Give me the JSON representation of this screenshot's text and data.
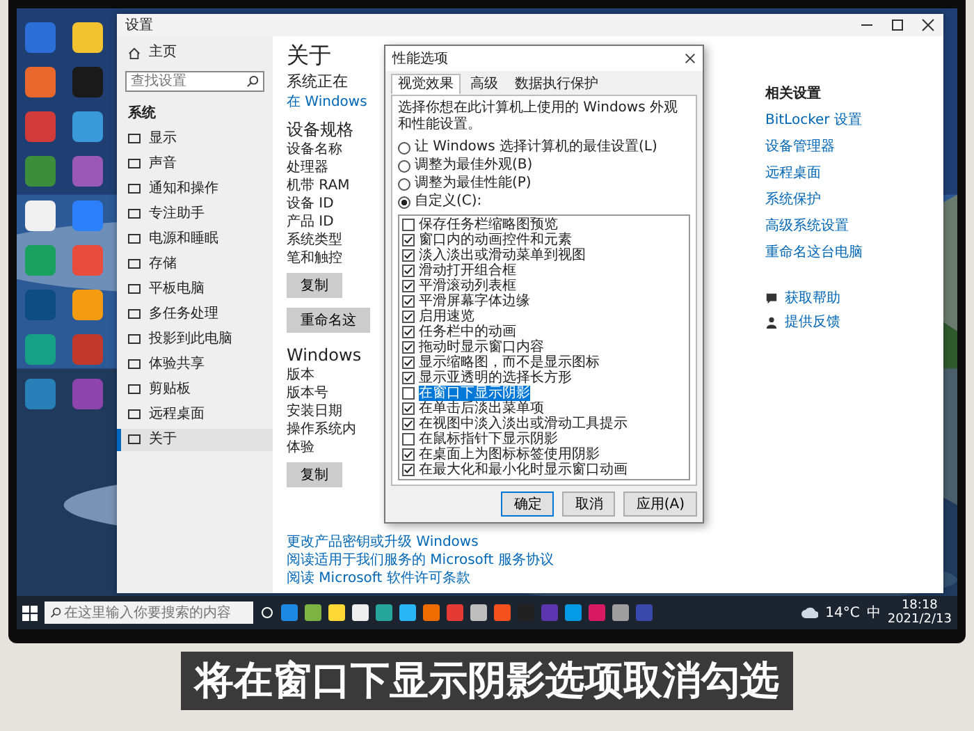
{
  "desktop_icons": [
    {
      "color": "#2b6fd6"
    },
    {
      "color": "#f2c230"
    },
    {
      "color": "#e8672c"
    },
    {
      "color": "#1a1a1a"
    },
    {
      "color": "#d23b3b"
    },
    {
      "color": "#3a9ad9"
    },
    {
      "color": "#3c8d3c"
    },
    {
      "color": "#9b59b6"
    },
    {
      "color": "#f0f0f0"
    },
    {
      "color": "#2d7ff9"
    },
    {
      "color": "#1aa15f"
    },
    {
      "color": "#e84c3d"
    },
    {
      "color": "#0f4c81"
    },
    {
      "color": "#f39c12"
    },
    {
      "color": "#16a085"
    },
    {
      "color": "#c0392b"
    },
    {
      "color": "#2980b9"
    },
    {
      "color": "#8e44ad"
    }
  ],
  "settings_window": {
    "title": "设置",
    "sidebar": {
      "home": "主页",
      "search_placeholder": "查找设置",
      "section": "系统",
      "items": [
        {
          "label": "显示",
          "selected": false
        },
        {
          "label": "声音",
          "selected": false
        },
        {
          "label": "通知和操作",
          "selected": false
        },
        {
          "label": "专注助手",
          "selected": false
        },
        {
          "label": "电源和睡眠",
          "selected": false
        },
        {
          "label": "存储",
          "selected": false
        },
        {
          "label": "平板电脑",
          "selected": false
        },
        {
          "label": "多任务处理",
          "selected": false
        },
        {
          "label": "投影到此电脑",
          "selected": false
        },
        {
          "label": "体验共享",
          "selected": false
        },
        {
          "label": "剪贴板",
          "selected": false
        },
        {
          "label": "远程桌面",
          "selected": false
        },
        {
          "label": "关于",
          "selected": true
        }
      ]
    },
    "main": {
      "title": "关于",
      "status": "系统正在",
      "security_link": "在 Windows",
      "specs_heading": "设备规格",
      "device_labels": [
        "设备名称",
        "处理器",
        "机带 RAM",
        "设备 ID",
        "产品 ID",
        "系统类型",
        "笔和触控"
      ],
      "copy_button": "复制",
      "rename_button": "重命名这",
      "windows_heading": "Windows",
      "windows_labels": [
        "版本",
        "版本号",
        "安装日期",
        "操作系统内",
        "体验"
      ],
      "copy_button_2": "复制",
      "links": [
        "更改产品密钥或升级 Windows",
        "阅读适用于我们服务的 Microsoft 服务协议",
        "阅读 Microsoft 软件许可条款"
      ]
    },
    "related": {
      "heading": "相关设置",
      "links": [
        "BitLocker 设置",
        "设备管理器",
        "远程桌面",
        "系统保护",
        "高级系统设置",
        "重命名这台电脑"
      ],
      "help_links": [
        "获取帮助",
        "提供反馈"
      ]
    }
  },
  "performance_dialog": {
    "title": "性能选项",
    "tabs": [
      {
        "label": "视觉效果",
        "selected": true
      },
      {
        "label": "高级",
        "selected": false
      },
      {
        "label": "数据执行保护",
        "selected": false
      }
    ],
    "description": "选择你想在此计算机上使用的 Windows 外观和性能设置。",
    "options": [
      {
        "label": "让 Windows 选择计算机的最佳设置(L)",
        "selected": false
      },
      {
        "label": "调整为最佳外观(B)",
        "selected": false
      },
      {
        "label": "调整为最佳性能(P)",
        "selected": false
      },
      {
        "label": "自定义(C):",
        "selected": true
      }
    ],
    "effects": [
      {
        "label": "保存任务栏缩略图预览",
        "checked": false,
        "selected": false
      },
      {
        "label": "窗口内的动画控件和元素",
        "checked": true,
        "selected": false
      },
      {
        "label": "淡入淡出或滑动菜单到视图",
        "checked": true,
        "selected": false
      },
      {
        "label": "滑动打开组合框",
        "checked": true,
        "selected": false
      },
      {
        "label": "平滑滚动列表框",
        "checked": true,
        "selected": false
      },
      {
        "label": "平滑屏幕字体边缘",
        "checked": true,
        "selected": false
      },
      {
        "label": "启用速览",
        "checked": true,
        "selected": false
      },
      {
        "label": "任务栏中的动画",
        "checked": true,
        "selected": false
      },
      {
        "label": "拖动时显示窗口内容",
        "checked": true,
        "selected": false
      },
      {
        "label": "显示缩略图，而不是显示图标",
        "checked": true,
        "selected": false
      },
      {
        "label": "显示亚透明的选择长方形",
        "checked": true,
        "selected": false
      },
      {
        "label": "在窗口下显示阴影",
        "checked": false,
        "selected": true
      },
      {
        "label": "在单击后淡出菜单项",
        "checked": true,
        "selected": false
      },
      {
        "label": "在视图中淡入淡出或滑动工具提示",
        "checked": true,
        "selected": false
      },
      {
        "label": "在鼠标指针下显示阴影",
        "checked": false,
        "selected": false
      },
      {
        "label": "在桌面上为图标标签使用阴影",
        "checked": true,
        "selected": false
      },
      {
        "label": "在最大化和最小化时显示窗口动画",
        "checked": true,
        "selected": false
      }
    ],
    "buttons": [
      {
        "label": "确定",
        "primary": true
      },
      {
        "label": "取消",
        "primary": false
      },
      {
        "label": "应用(A)",
        "primary": false
      }
    ]
  },
  "taskbar": {
    "search_placeholder": "在这里输入你要搜索的内容",
    "apps": [
      {
        "color": "#1e88e5"
      },
      {
        "color": "#7cb342"
      },
      {
        "color": "#fdd835"
      },
      {
        "color": "#eeeeee"
      },
      {
        "color": "#26a69a"
      },
      {
        "color": "#29b6f6"
      },
      {
        "color": "#ef6c00"
      },
      {
        "color": "#e53935"
      },
      {
        "color": "#bdbdbd"
      },
      {
        "color": "#f4511e"
      },
      {
        "color": "#212121"
      },
      {
        "color": "#5e35b1"
      },
      {
        "color": "#039be5"
      },
      {
        "color": "#d81b60"
      },
      {
        "color": "#9e9e9e"
      },
      {
        "color": "#3949ab"
      }
    ],
    "weather": "14°C",
    "ime": "中",
    "time": "18:18",
    "date": "2021/2/13"
  },
  "caption": "将在窗口下显示阴影选项取消勾选"
}
